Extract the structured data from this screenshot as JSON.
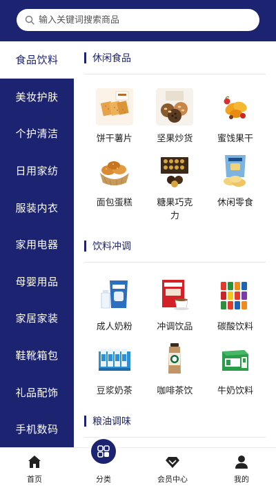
{
  "search": {
    "placeholder": "输入关键词搜索商品"
  },
  "sidebar": {
    "items": [
      {
        "label": "食品饮料"
      },
      {
        "label": "美妆护肤"
      },
      {
        "label": "个护清洁"
      },
      {
        "label": "日用家纺"
      },
      {
        "label": "服装内衣"
      },
      {
        "label": "家用电器"
      },
      {
        "label": "母婴用品"
      },
      {
        "label": "家居家装"
      },
      {
        "label": "鞋靴箱包"
      },
      {
        "label": "礼品配饰"
      },
      {
        "label": "手机数码"
      }
    ]
  },
  "sections": [
    {
      "title": "休闲食品",
      "items": [
        {
          "label": "饼干薯片"
        },
        {
          "label": "坚果炒货"
        },
        {
          "label": "蜜饯果干"
        },
        {
          "label": "面包蛋糕"
        },
        {
          "label": "糖果巧克力"
        },
        {
          "label": "休闲零食"
        }
      ]
    },
    {
      "title": "饮料冲调",
      "items": [
        {
          "label": "成人奶粉"
        },
        {
          "label": "冲调饮品"
        },
        {
          "label": "碳酸饮料"
        },
        {
          "label": "豆浆奶茶"
        },
        {
          "label": "咖啡茶饮"
        },
        {
          "label": "牛奶饮料"
        }
      ]
    },
    {
      "title": "粮油调味"
    }
  ],
  "tabbar": {
    "home": "首页",
    "category": "分类",
    "member": "会员中心",
    "mine": "我的"
  },
  "colors": {
    "primary": "#1c2370"
  }
}
